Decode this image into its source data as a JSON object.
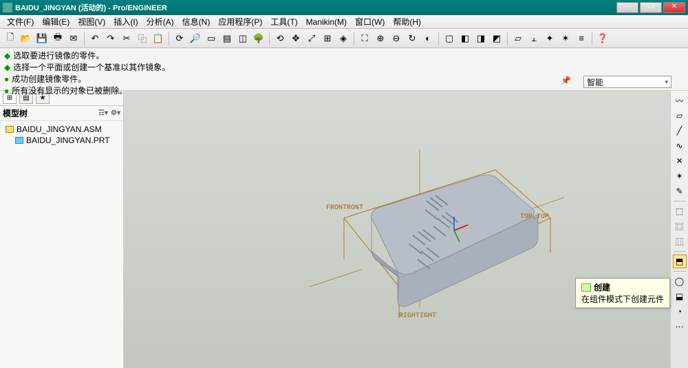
{
  "title": "BAIDU_JINGYAN (活动的) - Pro/ENGINEER",
  "menus": [
    "文件(F)",
    "编辑(E)",
    "视图(V)",
    "插入(I)",
    "分析(A)",
    "信息(N)",
    "应用程序(P)",
    "工具(T)",
    "Manikin(M)",
    "窗口(W)",
    "帮助(H)"
  ],
  "messages": [
    "选取要进行镜像的零件。",
    "选择一个平面或创建一个基准以其作镜象。",
    "成功创建镜像零件。",
    "所有没有显示的对象已被删除。"
  ],
  "smart_filter": "智能",
  "tree_title": "模型树",
  "tree": {
    "root": "BAIDU_JINGYAN.ASM",
    "child": "BAIDU_JINGYAN.PRT"
  },
  "datums": {
    "front": "FRONTRONT",
    "top": "TOP_TOP",
    "right": "RIGHTIGHT"
  },
  "tooltip": {
    "title": "创建",
    "desc": "在组件模式下创建元件"
  },
  "colors": {
    "accent": "#008080",
    "warn": "#c80"
  }
}
